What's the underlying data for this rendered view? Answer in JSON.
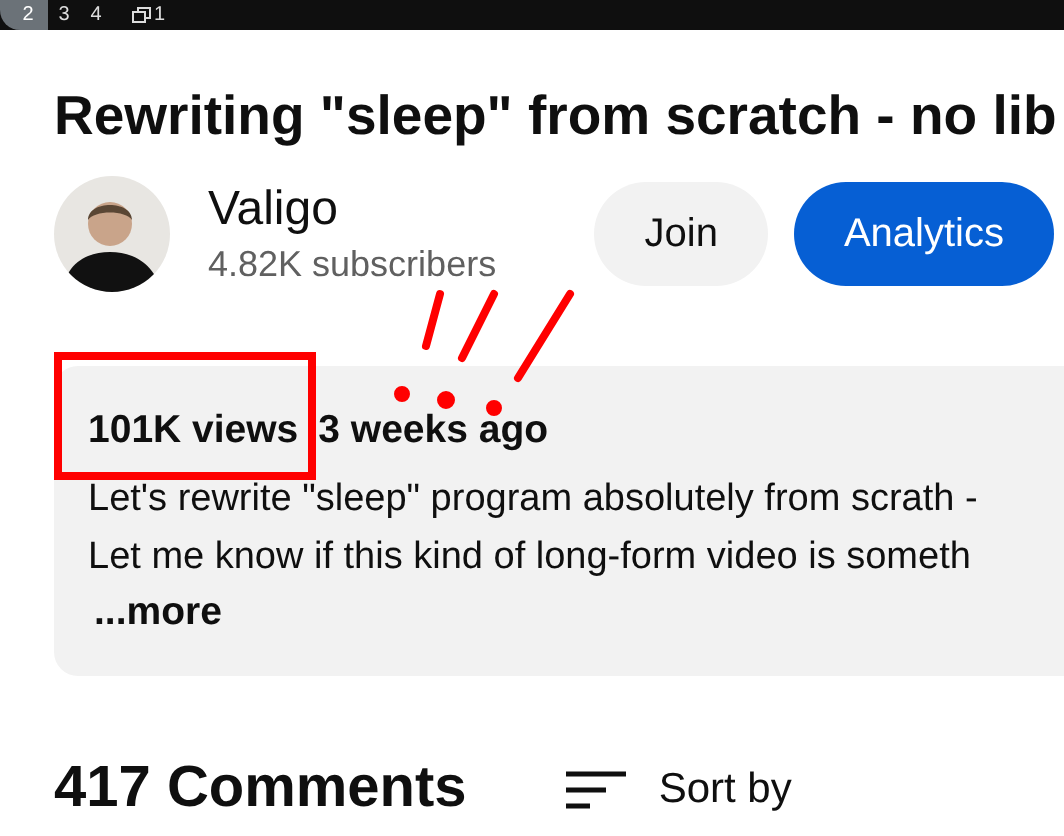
{
  "top_bar": {
    "tabs": [
      {
        "label": "2",
        "selected": true
      },
      {
        "label": "3",
        "selected": false
      },
      {
        "label": "4",
        "selected": false
      }
    ],
    "windows_count": "1"
  },
  "video": {
    "title": "Rewriting \"sleep\" from scratch - no lib"
  },
  "channel": {
    "name": "Valigo",
    "subscribers": "4.82K subscribers"
  },
  "buttons": [
    {
      "label": "Join",
      "kind": "secondary"
    },
    {
      "label": "Analytics",
      "kind": "primary"
    }
  ],
  "description": {
    "views": "101K views",
    "age": "3 weeks ago",
    "lines": [
      "Let's rewrite \"sleep\" program absolutely from scrath -",
      "Let me know if this kind of long-form video is someth"
    ],
    "more": "...more"
  },
  "comments": {
    "count": "417 Comments",
    "sort": "Sort by"
  }
}
